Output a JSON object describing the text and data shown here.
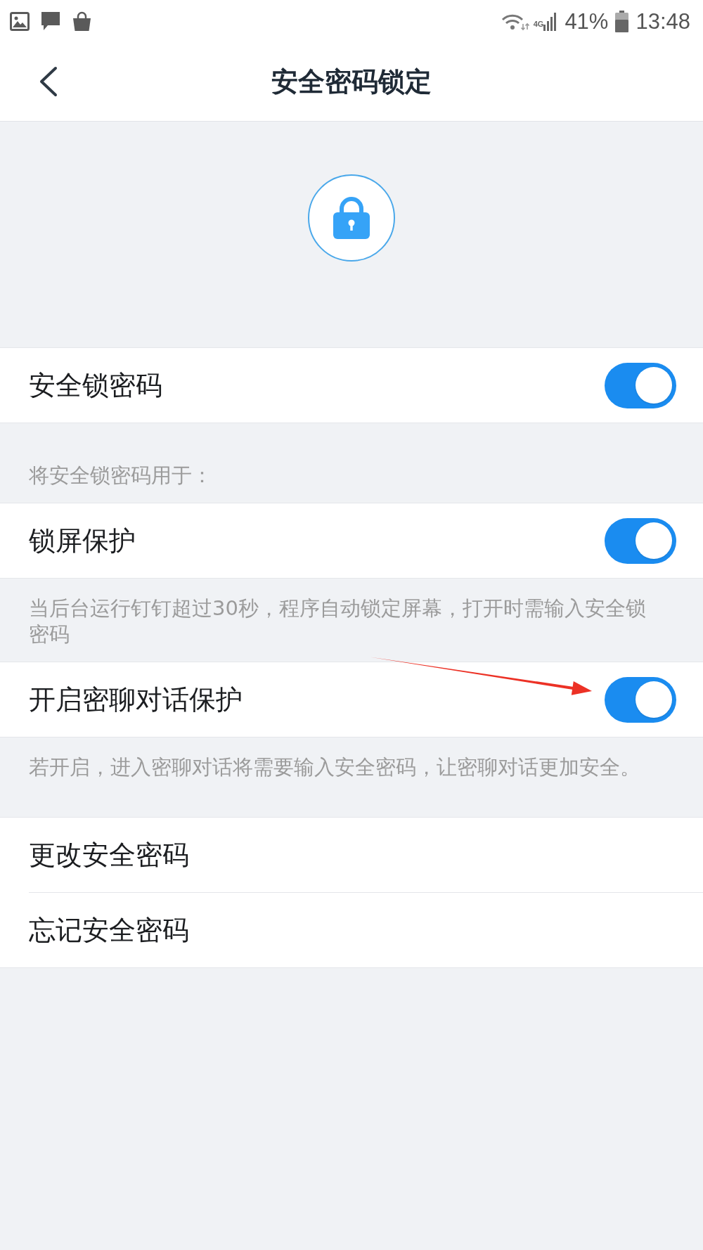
{
  "status_bar": {
    "network": "4G",
    "battery": "41%",
    "time": "13:48"
  },
  "header": {
    "title": "安全密码锁定"
  },
  "groups": [
    {
      "rows": [
        {
          "kind": "toggle",
          "label": "安全锁密码",
          "on": true
        }
      ]
    },
    {
      "caption": "将安全锁密码用于：",
      "rows": [
        {
          "kind": "toggle",
          "label": "锁屏保护",
          "on": true,
          "note": "当后台运行钉钉超过30秒，程序自动锁定屏幕，打开时需输入安全锁密码"
        },
        {
          "kind": "toggle",
          "label": "开启密聊对话保护",
          "on": true,
          "note": "若开启，进入密聊对话将需要输入安全密码，让密聊对话更加安全。"
        }
      ]
    },
    {
      "rows": [
        {
          "kind": "link",
          "label": "更改安全密码"
        },
        {
          "kind": "link",
          "label": "忘记安全密码"
        }
      ]
    }
  ]
}
